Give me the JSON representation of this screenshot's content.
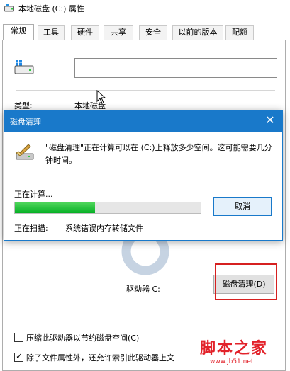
{
  "window": {
    "title": "本地磁盘 (C:) 属性",
    "icon": "drive-icon"
  },
  "tabs": [
    {
      "label": "常规",
      "active": true
    },
    {
      "label": "工具",
      "active": false
    },
    {
      "label": "硬件",
      "active": false
    },
    {
      "label": "共享",
      "active": false
    },
    {
      "label": "安全",
      "active": false
    },
    {
      "label": "以前的版本",
      "active": false
    },
    {
      "label": "配额",
      "active": false
    }
  ],
  "general": {
    "volume_label_value": "",
    "type_label": "类型:",
    "type_value": "本地磁盘",
    "drive_label": "驱动器 C:",
    "disk_cleanup_button": "磁盘清理(D)",
    "compress_checkbox": {
      "label": "压缩此驱动器以节约磁盘空间(C)",
      "checked": false
    },
    "index_checkbox": {
      "label": "除了文件属性外，还允许索引此驱动器上文",
      "checked": true
    }
  },
  "dialog": {
    "title": "磁盘清理",
    "message": "\"磁盘清理\"正在计算可以在 (C:)上释放多少空间。这可能需要几分钟时间。",
    "calculating_label": "正在计算...",
    "progress": 0.43,
    "cancel_button": "取消",
    "scanning_label": "正在扫描:",
    "scanning_value": "系统错误内存转储文件"
  },
  "watermark": {
    "text": "脚本之家",
    "url": "www.jb51.net"
  },
  "colors": {
    "accent": "#1979ca",
    "progress_green": "#06b025",
    "highlight_red": "#d62020",
    "watermark_red": "#e2222a"
  }
}
